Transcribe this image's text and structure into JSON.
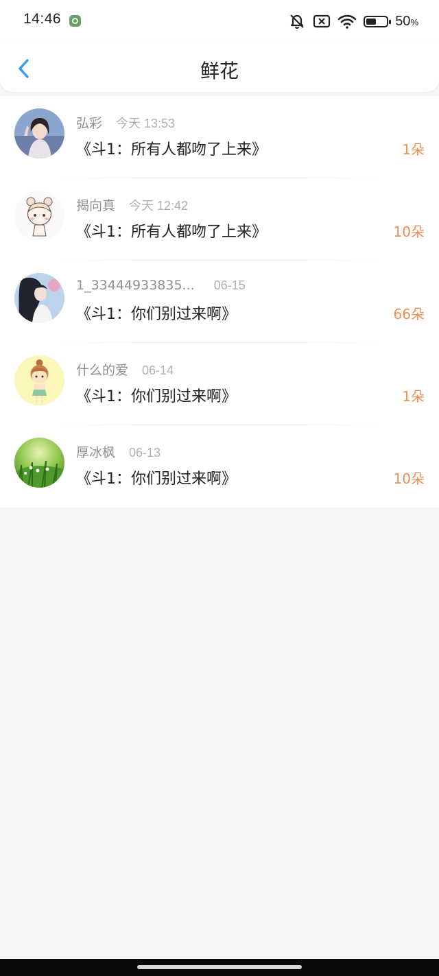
{
  "status_bar": {
    "time": "14:46",
    "battery_percent": "50",
    "battery_unit": "%",
    "battery_level": 0.5,
    "icons": [
      "app-badge-icon",
      "mute-icon",
      "sim-off-icon",
      "wifi-icon",
      "battery-icon"
    ]
  },
  "header": {
    "title": "鲜花",
    "back_icon": "chevron-left-icon"
  },
  "colors": {
    "accent_back": "#2f9cf0",
    "flower_count": "#ed8f55",
    "background": "#f7f5f6"
  },
  "items": [
    {
      "username": "弘彩",
      "time": "今天 13:53",
      "title": "《斗1：所有人都吻了上来》",
      "count": "1朵"
    },
    {
      "username": "揭向真",
      "time": "今天 12:42",
      "title": "《斗1：所有人都吻了上来》",
      "count": "10朵"
    },
    {
      "username": "1_33444933835...",
      "time": "06-15",
      "title": "《斗1：你们别过来啊》",
      "count": "66朵"
    },
    {
      "username": "什么的爱",
      "time": "06-14",
      "title": "《斗1：你们别过来啊》",
      "count": "1朵"
    },
    {
      "username": "厚冰枫",
      "time": "06-13",
      "title": "《斗1：你们别过来啊》",
      "count": "10朵"
    }
  ]
}
